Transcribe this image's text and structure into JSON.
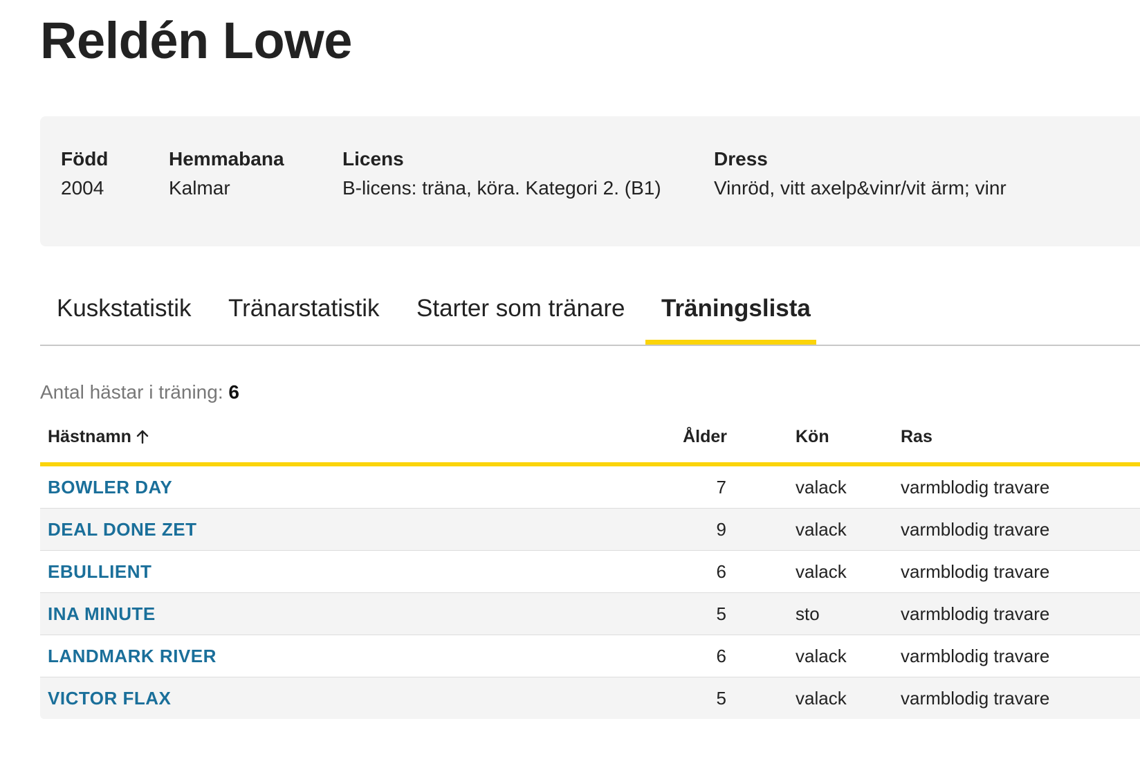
{
  "page": {
    "title": "Reldén Lowe"
  },
  "info": {
    "fodd": {
      "label": "Född",
      "value": "2004"
    },
    "hemmabana": {
      "label": "Hemmabana",
      "value": "Kalmar"
    },
    "licens": {
      "label": "Licens",
      "value": "B-licens: träna, köra. Kategori 2. (B1)"
    },
    "dress": {
      "label": "Dress",
      "value": "Vinröd, vitt axelp&vinr/vit ärm; vinr"
    }
  },
  "tabs": [
    {
      "label": "Kuskstatistik",
      "active": false
    },
    {
      "label": "Tränarstatistik",
      "active": false
    },
    {
      "label": "Starter som tränare",
      "active": false
    },
    {
      "label": "Träningslista",
      "active": true
    }
  ],
  "summary": {
    "label": "Antal hästar i träning:",
    "count": "6"
  },
  "table": {
    "columns": {
      "name": "Hästnamn",
      "age": "Ålder",
      "kon": "Kön",
      "ras": "Ras"
    },
    "sort_icon": "arrow-up-icon",
    "rows": [
      {
        "name": "BOWLER DAY",
        "age": "7",
        "kon": "valack",
        "ras": "varmblodig travare"
      },
      {
        "name": "DEAL DONE ZET",
        "age": "9",
        "kon": "valack",
        "ras": "varmblodig travare"
      },
      {
        "name": "EBULLIENT",
        "age": "6",
        "kon": "valack",
        "ras": "varmblodig travare"
      },
      {
        "name": "INA MINUTE",
        "age": "5",
        "kon": "sto",
        "ras": "varmblodig travare"
      },
      {
        "name": "LANDMARK RIVER",
        "age": "6",
        "kon": "valack",
        "ras": "varmblodig travare"
      },
      {
        "name": "VICTOR FLAX",
        "age": "5",
        "kon": "valack",
        "ras": "varmblodig travare"
      }
    ]
  },
  "colors": {
    "accent": "#fbd40a",
    "link": "#1a6f9a",
    "panel": "#f4f4f4"
  }
}
